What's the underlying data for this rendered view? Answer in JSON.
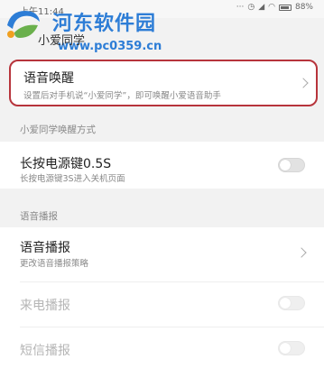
{
  "status_bar": {
    "time": "上午11:44",
    "battery": "88%"
  },
  "watermark": {
    "title": "河东软件园",
    "url": "www.pc0359.cn"
  },
  "page_title": "小爱同学",
  "voice_wake": {
    "title": "语音唤醒",
    "subtitle": "设置后对手机说“小爱同学”，即可唤醒小爱语音助手"
  },
  "wake_method": {
    "section_label": "小爱同学唤醒方式",
    "power_key": {
      "title": "长按电源键0.5S",
      "subtitle": "长按电源键3S进入关机页面",
      "enabled": false
    }
  },
  "voice_broadcast": {
    "section_label": "语音播报",
    "broadcast_item": {
      "title": "语音播报",
      "subtitle": "更改语音播报策略"
    },
    "incoming_call": {
      "title": "来电播报",
      "enabled": false
    },
    "sms": {
      "title": "短信播报",
      "enabled": false
    }
  }
}
